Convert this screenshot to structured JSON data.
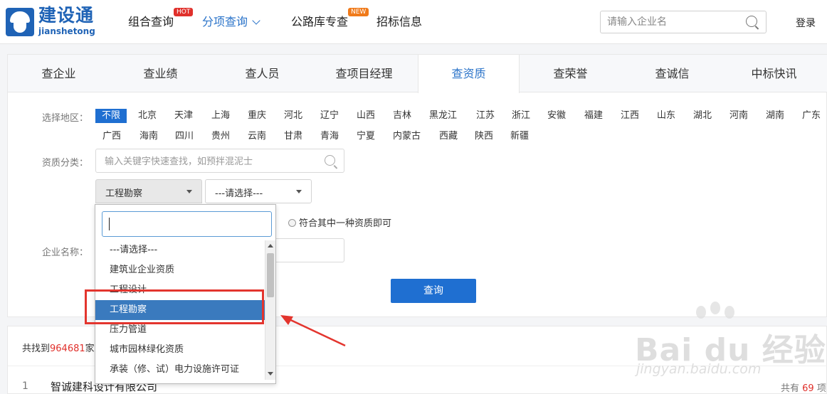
{
  "header": {
    "logo_cn": "建设通",
    "logo_en": "jianshetong",
    "nav": [
      {
        "label": "组合查询",
        "badge": "HOT"
      },
      {
        "label": "分项查询"
      },
      {
        "label": "公路库专查",
        "badge": "NEW"
      },
      {
        "label": "招标信息"
      }
    ],
    "search_placeholder": "请输入企业名",
    "login": "登录"
  },
  "tabs": [
    "查企业",
    "查业绩",
    "查人员",
    "查项目经理",
    "查资质",
    "查荣誉",
    "查诚信",
    "中标快讯"
  ],
  "active_tab": "查资质",
  "filters": {
    "region_label": "选择地区：",
    "regions_row1": [
      "不限",
      "北京",
      "天津",
      "上海",
      "重庆",
      "河北",
      "辽宁",
      "山西",
      "吉林",
      "黑龙江",
      "江苏",
      "浙江",
      "安徽",
      "福建",
      "江西",
      "山东",
      "湖北",
      "河南",
      "湖南",
      "广东"
    ],
    "regions_row2": [
      "广西",
      "海南",
      "四川",
      "贵州",
      "云南",
      "甘肃",
      "青海",
      "宁夏",
      "内蒙古",
      "西藏",
      "陕西",
      "新疆"
    ],
    "selected_region": "不限",
    "qual_label": "资质分类：",
    "qual_placeholder": "输入关键字快速查找，如预拌混泥士",
    "select1_value": "工程勘察",
    "select2_value": "---请选择---",
    "radio_label": "符合其中一种资质即可",
    "company_label": "企业名称：",
    "query_button": "查询"
  },
  "dropdown": {
    "search_value": "",
    "options": [
      "---请选择---",
      "建筑业企业资质",
      "工程设计",
      "工程勘察",
      "压力管道",
      "城市园林绿化资质",
      "承装（修、试）电力设施许可证"
    ],
    "highlighted": "工程勘察"
  },
  "results": {
    "found_prefix": "共找到",
    "found_count": "964681",
    "found_suffix": "家",
    "row_index": "1",
    "row_company": "智诚建科设计有限公司",
    "total_prefix": "共有",
    "total_count": "69",
    "total_suffix": "项"
  },
  "watermark": {
    "text": "Bai du 经验",
    "sub": "jingyan.baidu.com"
  },
  "colors": {
    "brand": "#1f63b6",
    "accent": "#1f6fd1",
    "highlight": "#3a7abe",
    "annotation": "#e3352e"
  }
}
